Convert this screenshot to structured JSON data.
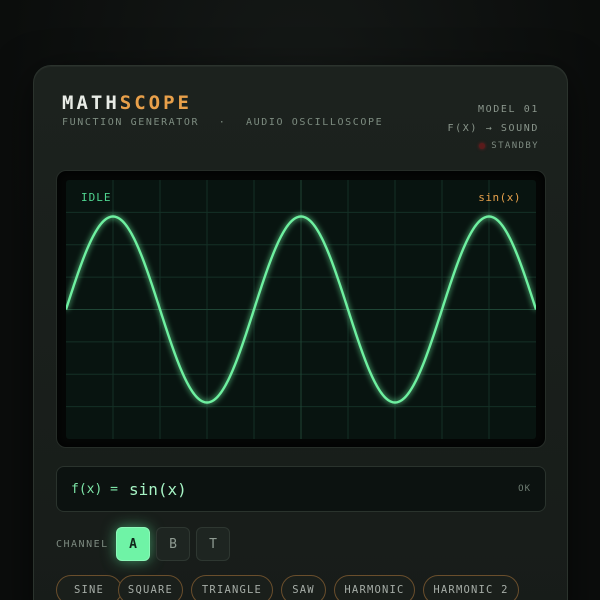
{
  "header": {
    "brand_part1": "MATH",
    "brand_part2": "SCOPE",
    "subtitle_left": "FUNCTION GENERATOR",
    "subtitle_sep": "·",
    "subtitle_right": "AUDIO OSCILLOSCOPE",
    "model": "MODEL 01",
    "tagline": "F(X) → SOUND",
    "status": "STANDBY"
  },
  "scope": {
    "state": "IDLE",
    "function_label": "sin(x)",
    "trace_color": "#6ef0a0"
  },
  "function_input": {
    "prefix": "f(x) =",
    "value": "sin(x)",
    "status": "OK"
  },
  "channel": {
    "label": "CHANNEL",
    "options": [
      "A",
      "B",
      "T"
    ],
    "selected": "A"
  },
  "waveforms": [
    "SINE",
    "SQUARE",
    "TRIANGLE",
    "SAW",
    "HARMONIC",
    "HARMONIC 2"
  ],
  "colors": {
    "accent_green": "#6ff3a6",
    "accent_orange": "#e8a04a",
    "status_led": "#5a1b1b"
  }
}
